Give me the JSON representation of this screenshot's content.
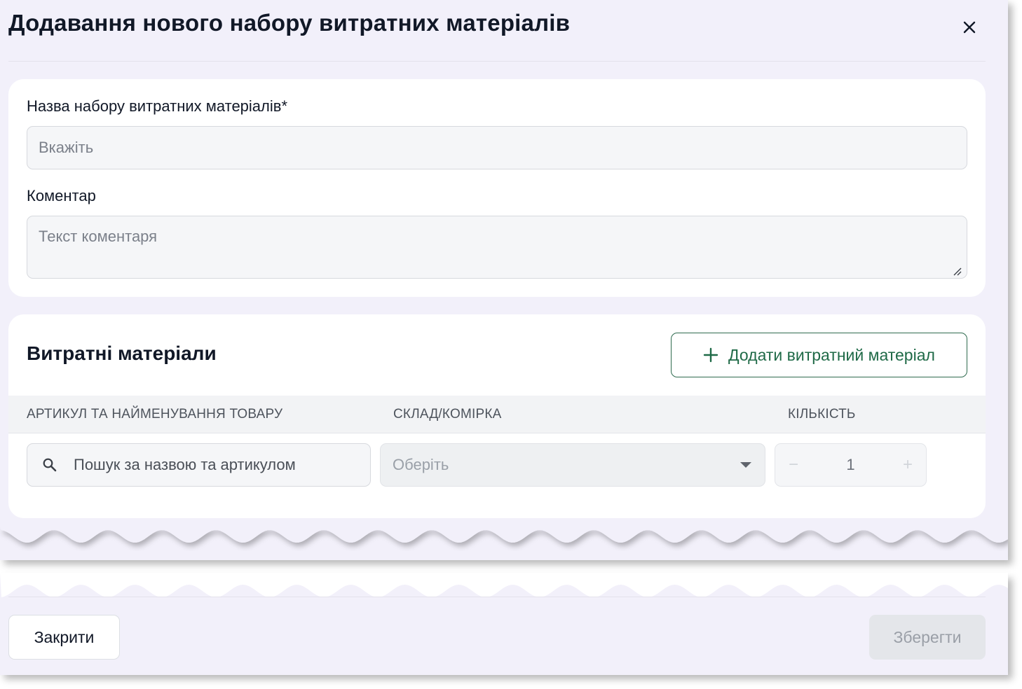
{
  "modal": {
    "title": "Додавання нового набору витратних матеріалів",
    "close_icon": "close-icon"
  },
  "form": {
    "name_label": "Назва набору витратних матеріалів*",
    "name_placeholder": "Вкажіть",
    "name_value": "",
    "comment_label": "Коментар",
    "comment_placeholder": "Текст коментаря",
    "comment_value": ""
  },
  "materials": {
    "section_title": "Витратні матеріали",
    "add_button_label": "Додати витратний матеріал",
    "add_button_icon": "plus-icon",
    "columns": [
      "АРТИКУЛ ТА НАЙМЕНУВАННЯ ТОВАРУ",
      "СКЛАД/КОМІРКА",
      "КІЛЬКІСТЬ"
    ],
    "rows": [
      {
        "search_placeholder": "Пошук за назвою та артикулом",
        "search_icon": "search-icon",
        "warehouse_placeholder": "Оберіть",
        "quantity": "1",
        "decrement_label": "−",
        "increment_label": "+"
      }
    ]
  },
  "footer": {
    "close_label": "Закрити",
    "save_label": "Зберегти"
  },
  "colors": {
    "modal_bg": "#f2f0fa",
    "card_bg": "#ffffff",
    "accent_green": "#1f6a47",
    "text_primary": "#111827",
    "disabled_bg": "#e4e6ea"
  }
}
